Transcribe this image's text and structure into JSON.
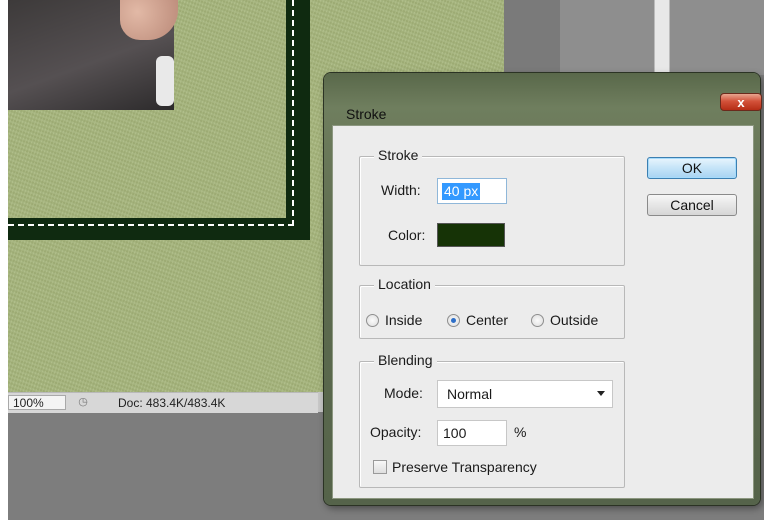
{
  "workspace": {
    "zoom": "100%",
    "doc_info": "Doc: 483.4K/483.4K"
  },
  "dialog": {
    "title": "Stroke",
    "close_label": "x",
    "ok_label": "OK",
    "cancel_label": "Cancel",
    "stroke_group": {
      "legend": "Stroke",
      "width_label": "Width:",
      "width_value": "40 px",
      "color_label": "Color:",
      "color_value": "#163306"
    },
    "location_group": {
      "legend": "Location",
      "options": [
        {
          "label": "Inside",
          "checked": false
        },
        {
          "label": "Center",
          "checked": true
        },
        {
          "label": "Outside",
          "checked": false
        }
      ]
    },
    "blending_group": {
      "legend": "Blending",
      "mode_label": "Mode:",
      "mode_value": "Normal",
      "opacity_label": "Opacity:",
      "opacity_value": "100",
      "opacity_unit": "%",
      "preserve_label": "Preserve Transparency",
      "preserve_checked": false
    }
  }
}
